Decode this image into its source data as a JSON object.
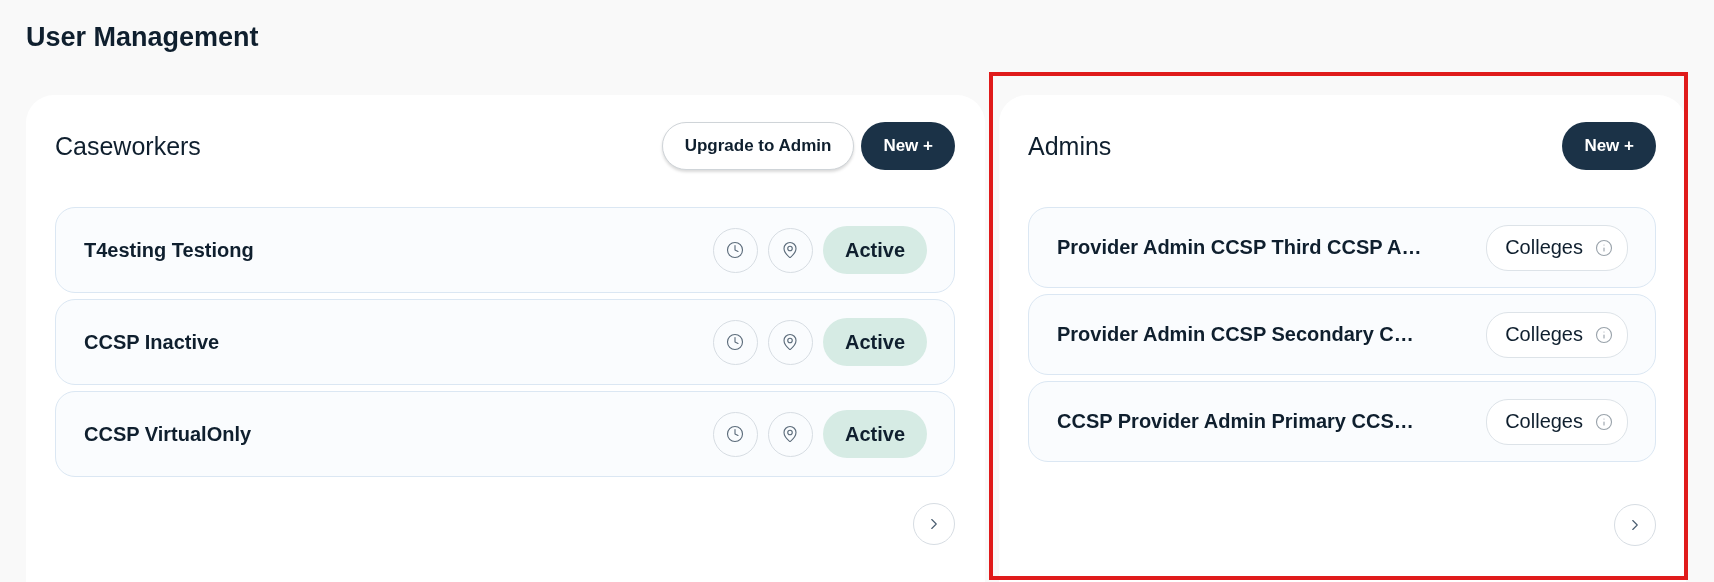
{
  "page_title": "User Management",
  "panels": [
    {
      "title": "Caseworkers",
      "highlighted": false,
      "buttons": [
        {
          "label": "Upgrade to Admin",
          "kind": "outline"
        },
        {
          "label": "New +",
          "kind": "primary"
        }
      ],
      "rows": [
        {
          "name": "T4esting Testiong",
          "kind": "caseworker",
          "status": "Active"
        },
        {
          "name": "CCSP Inactive",
          "kind": "caseworker",
          "status": "Active"
        },
        {
          "name": "CCSP VirtualOnly",
          "kind": "caseworker",
          "status": "Active"
        }
      ]
    },
    {
      "title": "Admins",
      "highlighted": true,
      "buttons": [
        {
          "label": "New +",
          "kind": "primary"
        }
      ],
      "rows": [
        {
          "name": "Provider Admin CCSP Third CCSP A…",
          "kind": "admin",
          "tag": "Colleges"
        },
        {
          "name": "Provider Admin CCSP Secondary C…",
          "kind": "admin",
          "tag": "Colleges"
        },
        {
          "name": "CCSP Provider Admin Primary CCS…",
          "kind": "admin",
          "tag": "Colleges"
        }
      ]
    }
  ]
}
